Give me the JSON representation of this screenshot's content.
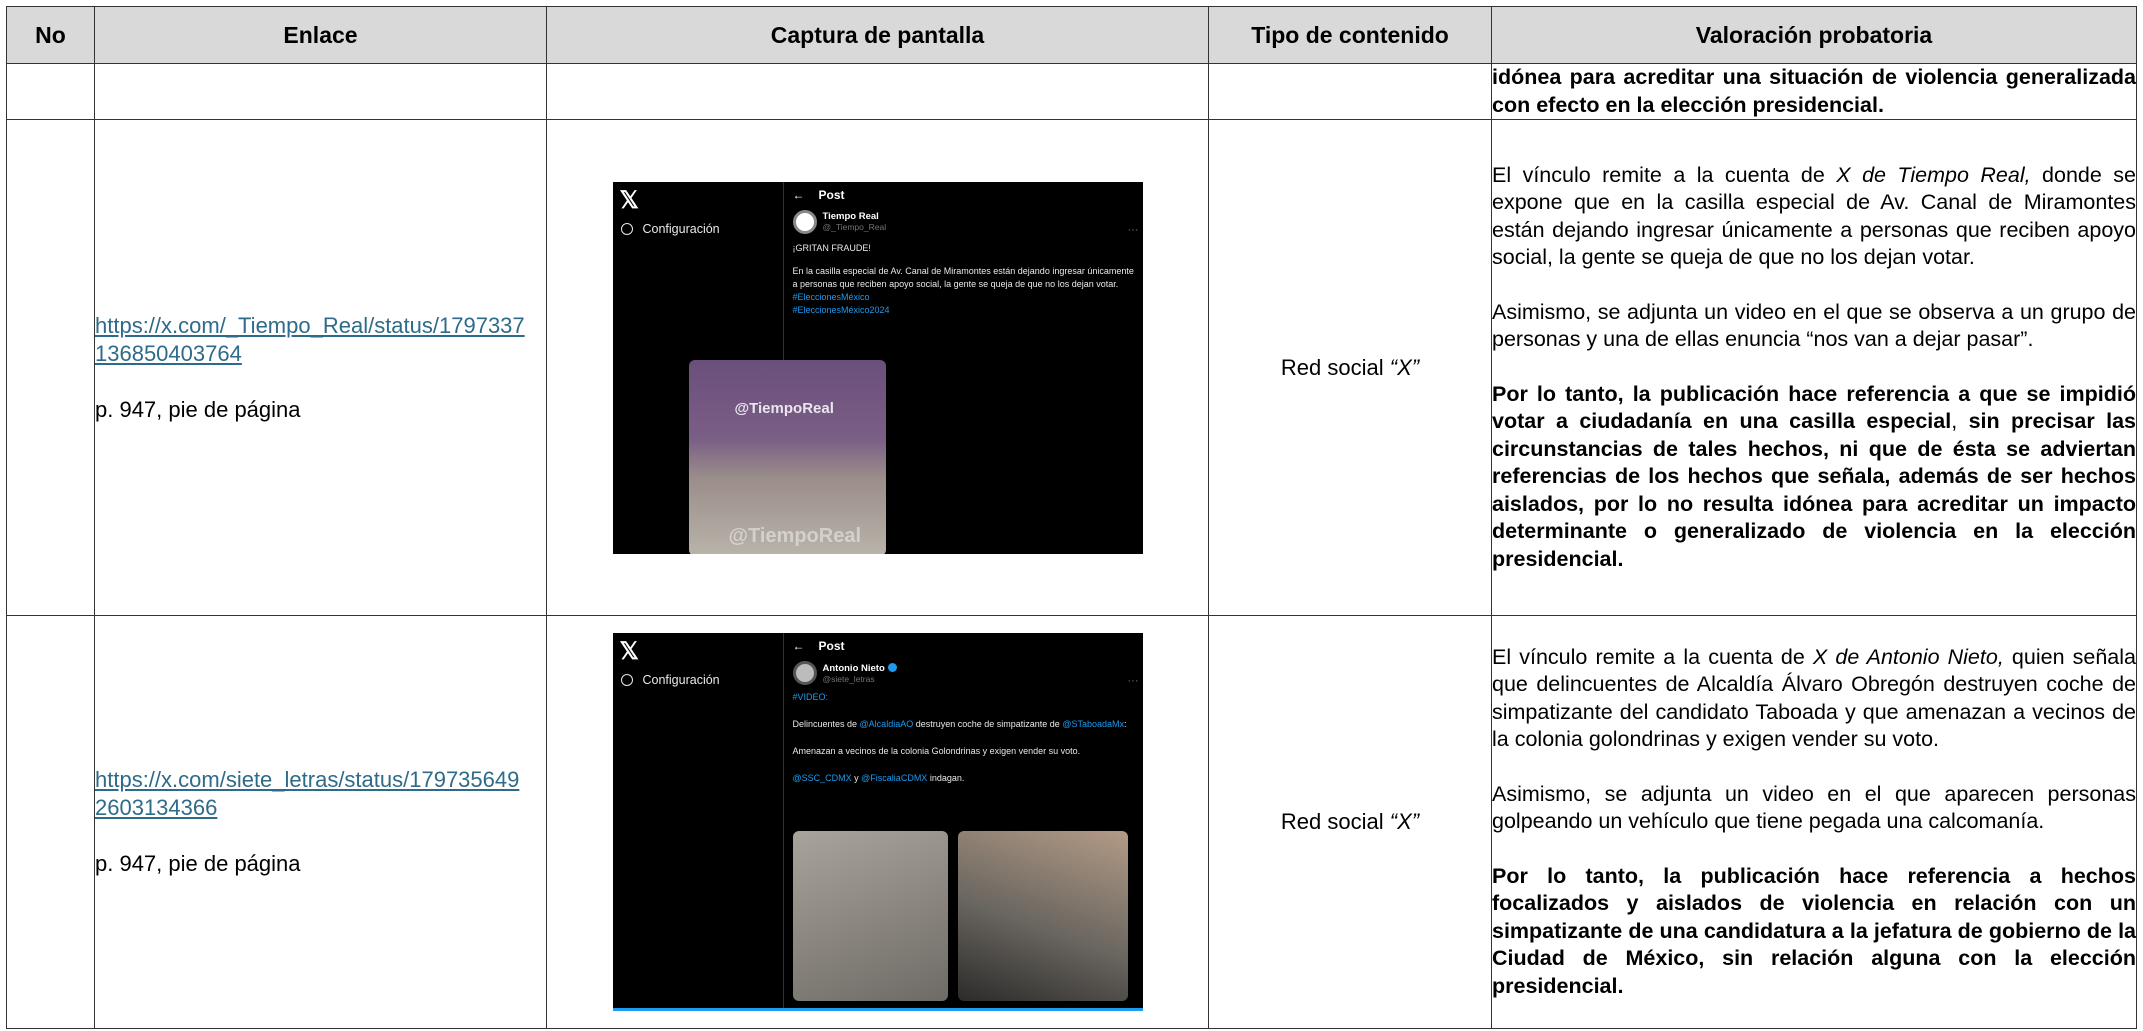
{
  "headers": [
    "No",
    "Enlace",
    "Captura de pantalla",
    "Tipo de contenido",
    "Valoración probatoria"
  ],
  "row0": {
    "valoracion_bold": "idónea para acreditar una situación de violencia generalizada con efecto en la elección presidencial."
  },
  "rows": [
    {
      "no": "",
      "link": "https://x.com/_Tiempo_Real/status/1797337136850403764",
      "page": "p. 947, pie de página",
      "tipo_prefix": "Red social ",
      "tipo_italic": "“X”",
      "val_p1_a": "El vínculo remite a la cuenta de ",
      "val_p1_i": "X de Tiempo Real,",
      "val_p1_b": " donde se expone que en la casilla especial de Av. Canal de Miramontes están dejando ingresar únicamente a personas que reciben apoyo social, la gente se queja de que no los dejan votar.",
      "val_p2": "Asimismo, se adjunta un video en el que se observa a un grupo de personas y una de ellas enuncia “nos van a dejar pasar”.",
      "val_p3_a": "Por lo tanto, la publicación hace referencia a que se impidió votar a ciudadanía en una casilla especial",
      "val_p3_b": ", ",
      "val_p3_c": "sin precisar las circunstancias de tales hechos, ni que de ésta se adviertan referencias de los hechos que señala, además de ser hechos aislados, por lo no resulta idónea para acreditar un impacto determinante o generalizado de violencia en la elección presidencial.",
      "tweet": {
        "logo": "𝕏",
        "config": "Configuración",
        "back": "←",
        "header": "Post",
        "author": "Tiempo Real",
        "handle": "@_Tiempo_Real",
        "more": "···",
        "line1": "¡GRITAN FRAUDE!",
        "body": "En la casilla especial de Av. Canal de Miramontes están dejando ingresar únicamente a personas que reciben apoyo social, la gente se queja de que no los dejan votar.",
        "tag1": "#EleccionesMéxico",
        "tag2": "#EleccionesMéxico2024",
        "watermark": "@TiempoReal",
        "watermark2": "@TiempoReal"
      }
    },
    {
      "no": "",
      "link": "https://x.com/siete_letras/status/1797356492603134366",
      "page": "p. 947, pie de página",
      "tipo_prefix": "Red social ",
      "tipo_italic": "“X”",
      "val_p1_a": "El vínculo remite a la cuenta de ",
      "val_p1_i": "X de Antonio Nieto,",
      "val_p1_b": " quien señala que delincuentes de Alcaldía Álvaro Obregón destruyen coche de simpatizante del candidato Taboada y que amenazan a vecinos de la colonia golondrinas y exigen vender su voto.",
      "val_p2": "Asimismo, se adjunta un video en el que aparecen personas golpeando un vehículo que tiene pegada una calcomanía.",
      "val_p3": "Por lo tanto, la publicación hace referencia a hechos focalizados y aislados de violencia en relación con un simpatizante de una candidatura a la jefatura de gobierno de la Ciudad de México, sin relación alguna con la elección presidencial.",
      "tweet": {
        "logo": "𝕏",
        "config": "Configuración",
        "back": "←",
        "header": "Post",
        "author": "Antonio Nieto",
        "handle": "@siete_letras",
        "more": "···",
        "tag_video": "#VIDEO:",
        "l1_a": "Delincuentes de ",
        "l1_m1": "@AlcaldiaAO",
        "l1_b": " destruyen coche de simpatizante de ",
        "l1_m2": "@STaboadaMx",
        "l1_c": ":",
        "l2": "Amenazan a vecinos de la colonia Golondrinas y exigen vender su voto.",
        "l3_m1": "@SSC_CDMX",
        "l3_y": " y ",
        "l3_m2": "@FiscaliaCDMX",
        "l3_c": " indagan."
      }
    }
  ]
}
